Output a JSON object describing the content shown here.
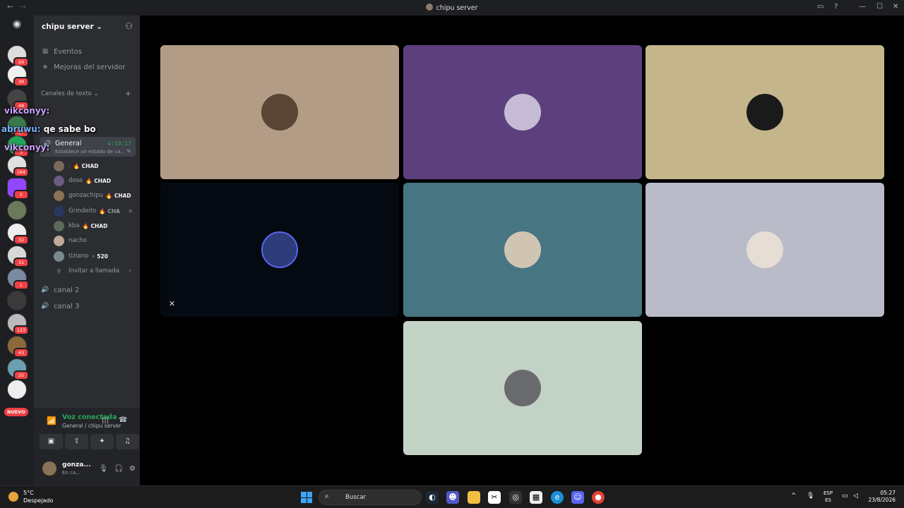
{
  "window": {
    "title": "chipu server",
    "back_glyph": "←",
    "forward_glyph": "→",
    "inbox_glyph": "▭",
    "help_glyph": "?",
    "minimize_glyph": "—",
    "maximize_glyph": "☐",
    "close_glyph": "✕"
  },
  "servers": {
    "home_glyph": "◉",
    "badges": [
      "29",
      "38",
      "48",
      "17",
      "3",
      "164",
      "2",
      "32",
      "31",
      "1",
      "123",
      "43",
      "25"
    ],
    "new_label": "NUEVO"
  },
  "server_header": {
    "name": "chipu server",
    "chevron": "⌄",
    "add_member_glyph": "⚇"
  },
  "channels": {
    "events_label": "Eventos",
    "boosts_label": "Mejoras del servidor",
    "text_category": "Canales de texto",
    "category_chevron": "⌄",
    "category_add": "+",
    "voice_active": {
      "name": "General",
      "timer": "4:10:17",
      "status_placeholder": "Establece un estado de ca...",
      "edit_glyph": "✎"
    },
    "members": [
      {
        "name": ".",
        "tag": "CHAD",
        "fire": "🔥",
        "color": "#7a6b5a"
      },
      {
        "name": "dose",
        "tag": "CHAD",
        "fire": "🔥",
        "color": "#6c5a82"
      },
      {
        "name": "gonzachipu",
        "tag": "CHAD",
        "fire": "🔥",
        "color": "#8a7255"
      },
      {
        "name": "Grindeito",
        "tag": "CHA",
        "fire": "🔥",
        "color": "#2a3760",
        "muted": "✕"
      },
      {
        "name": "kba",
        "tag": "CHAD",
        "fire": "🔥",
        "color": "#5b6a5a"
      },
      {
        "name": "nacho",
        "tag": "",
        "fire": "",
        "color": "#c0a89a"
      },
      {
        "name": "tiziano",
        "tag": "520",
        "fire": "⚡",
        "color": "#7a8a90"
      }
    ],
    "invite_label": "Invitar a llamada",
    "invite_chevron": "›",
    "voice_channels": [
      "canal 2",
      "canal 3"
    ]
  },
  "overlays": {
    "line1_name": "vikconyy:",
    "line2_name": "abruwu:",
    "line2_text": "qe sabe bo",
    "line3_name": "vikconyy:"
  },
  "voice_panel": {
    "title": "Voz conectada",
    "subtitle": "General / chipu server",
    "buttons": [
      "▣",
      "⇪",
      "✦",
      "♫"
    ]
  },
  "user": {
    "name": "gonza...",
    "status": "En ca...",
    "controls": [
      "🎙",
      "🎧",
      "⚙"
    ]
  },
  "tiles": [
    {
      "bg": "#b39c86",
      "avatar": "#5a4535",
      "row": 0,
      "col": 0
    },
    {
      "bg": "#5e3f7e",
      "avatar": "#c5bbd5",
      "row": 0,
      "col": 1
    },
    {
      "bg": "#c4b68a",
      "avatar": "#1a1a1a",
      "row": 0,
      "col": 2
    },
    {
      "bg": "#050a12",
      "avatar": "#2e3c7a",
      "row": 1,
      "col": 0,
      "muted": true
    },
    {
      "bg": "#477582",
      "avatar": "#d0c4b2",
      "row": 1,
      "col": 1
    },
    {
      "bg": "#b9bcc8",
      "avatar": "#e6ddd5",
      "row": 1,
      "col": 2
    },
    {
      "bg": "#c2d3c6",
      "avatar": "#6a6b6d",
      "row": 2,
      "col": 1
    }
  ],
  "taskbar": {
    "temperature": "5°C",
    "condition": "Despejado",
    "search_placeholder": "Buscar",
    "lang_top": "ESP",
    "lang_bottom": "ES",
    "time": "05:27",
    "date": "23/8/2026"
  }
}
